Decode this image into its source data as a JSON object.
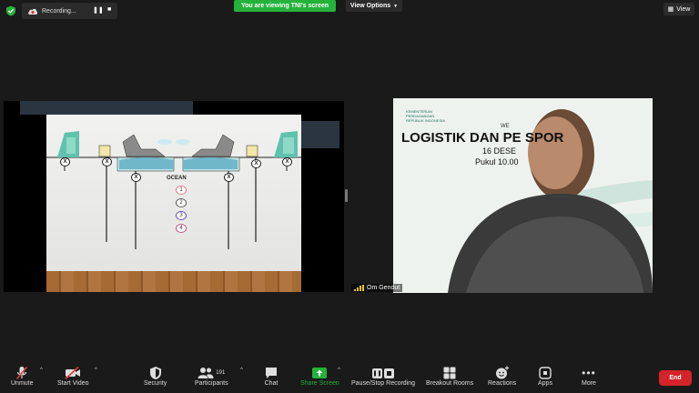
{
  "top_bar": {
    "recording_label": "Recording...",
    "viewing_banner": "You are viewing TNI's screen",
    "view_options": "View Options",
    "view_button": "View"
  },
  "shared_screen": {
    "ocean_label": "OCEAN",
    "x_label": "X",
    "numbers": [
      "1",
      "2",
      "3",
      "4"
    ],
    "number_colors": [
      "#e07a7a",
      "#5a5a5a",
      "#6a4fbf",
      "#c94f8a"
    ]
  },
  "video": {
    "slide_org": "KEMENTERIAN\nPERDAGANGAN\nREPUBLIK INDONESIA",
    "slide_we": "WE",
    "slide_title": "LOGISTIK DAN PE          SPOR",
    "slide_date": "16 DESE",
    "slide_time": "Pukul 10.00",
    "participant_name": "Om Gendut"
  },
  "toolbar": {
    "unmute": "Unmute",
    "start_video": "Start Video",
    "security": "Security",
    "participants": "Participants",
    "participants_count": "191",
    "chat": "Chat",
    "share_screen": "Share Screen",
    "pause_stop_recording": "Pause/Stop Recording",
    "breakout_rooms": "Breakout Rooms",
    "reactions": "Reactions",
    "apps": "Apps",
    "more": "More",
    "end": "End"
  },
  "colors": {
    "green_banner": "#24b23a",
    "share_green": "#24b23a",
    "end_red": "#d4232a",
    "muted_red": "#e03a3a"
  }
}
